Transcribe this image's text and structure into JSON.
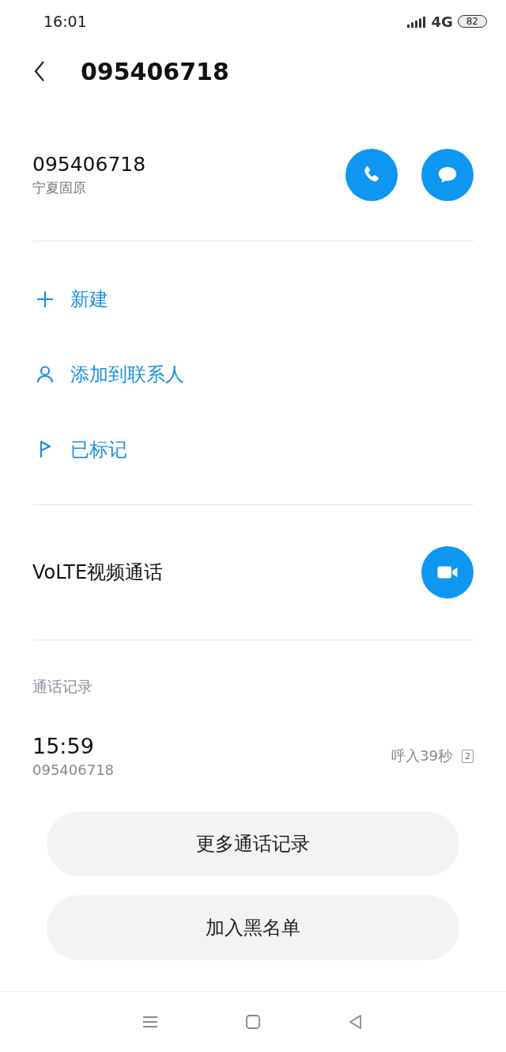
{
  "status_bar": {
    "time": "16:01",
    "network": "4G",
    "battery": "82"
  },
  "header": {
    "title": "095406718"
  },
  "contact": {
    "number": "095406718",
    "location": "宁夏固原"
  },
  "actions": [
    {
      "kind": "new",
      "label": "新建"
    },
    {
      "kind": "add_contact",
      "label": "添加到联系人"
    },
    {
      "kind": "marked",
      "label": "已标记"
    }
  ],
  "video_call": {
    "label": "VoLTE视频通话"
  },
  "call_log": {
    "heading": "通话记录",
    "entries": [
      {
        "time": "15:59",
        "number": "095406718",
        "summary": "呼入39秒",
        "sim": "2"
      }
    ]
  },
  "buttons": [
    "更多通话记录",
    "加入黑名单"
  ]
}
